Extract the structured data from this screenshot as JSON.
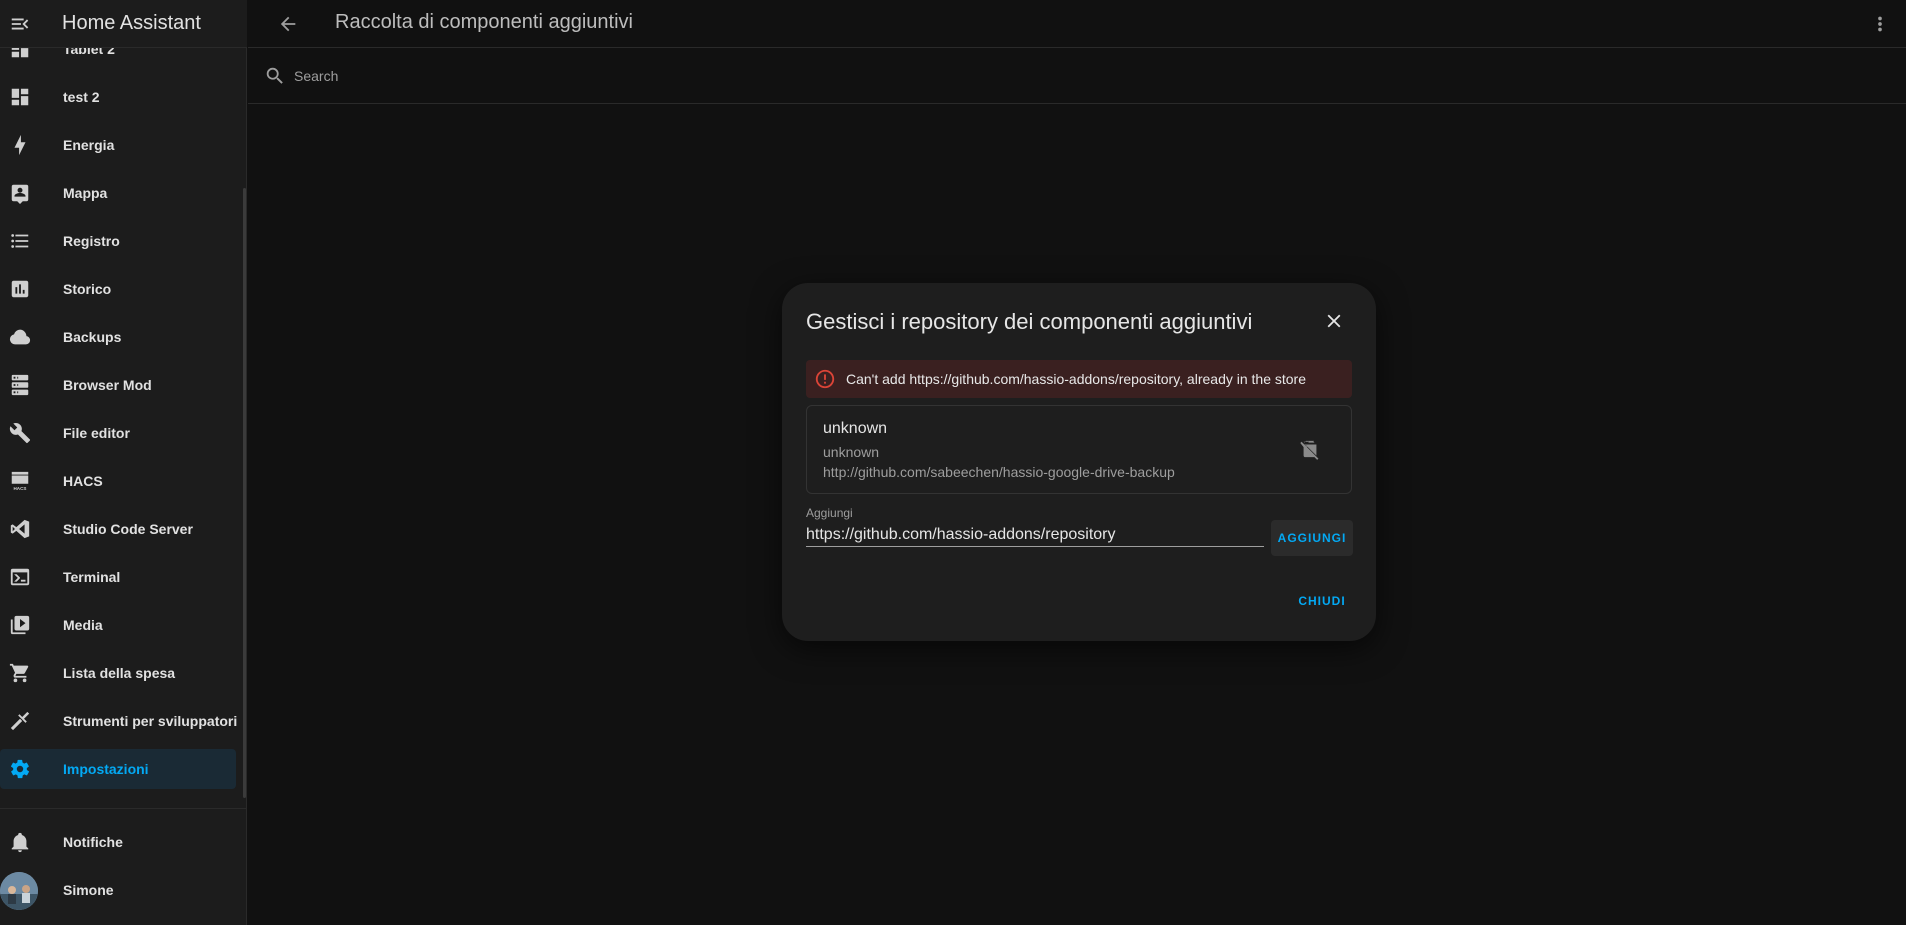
{
  "app": {
    "title": "Home Assistant"
  },
  "sidebar": {
    "items": [
      {
        "label": "Tablet 2",
        "icon": "view-dashboard-icon"
      },
      {
        "label": "test 2",
        "icon": "view-dashboard-icon"
      },
      {
        "label": "Energia",
        "icon": "lightning-bolt-icon"
      },
      {
        "label": "Mappa",
        "icon": "account-box-icon"
      },
      {
        "label": "Registro",
        "icon": "format-list-bulleted-icon"
      },
      {
        "label": "Storico",
        "icon": "chart-box-icon"
      },
      {
        "label": "Backups",
        "icon": "cloud-icon"
      },
      {
        "label": "Browser Mod",
        "icon": "server-icon"
      },
      {
        "label": "File editor",
        "icon": "wrench-icon"
      },
      {
        "label": "HACS",
        "icon": "hacs-icon"
      },
      {
        "label": "Studio Code Server",
        "icon": "vscode-icon"
      },
      {
        "label": "Terminal",
        "icon": "console-icon"
      },
      {
        "label": "Media",
        "icon": "play-box-multiple-icon"
      },
      {
        "label": "Lista della spesa",
        "icon": "cart-icon"
      },
      {
        "label": "Strumenti per sviluppatori",
        "icon": "hammer-icon"
      },
      {
        "label": "Impostazioni",
        "icon": "cog-icon",
        "active": true
      }
    ],
    "notifications_label": "Notifiche",
    "user_label": "Simone",
    "hacs_icon_text": "HACS"
  },
  "header": {
    "title": "Raccolta di componenti aggiuntivi"
  },
  "search": {
    "placeholder": "Search",
    "value": ""
  },
  "dialog": {
    "title": "Gestisci i repository dei componenti aggiuntivi",
    "error_text": "Can't add https://github.com/hassio-addons/repository, already in the store",
    "repository": {
      "name": "unknown",
      "maintainer": "unknown",
      "url": "http://github.com/sabeechen/hassio-google-drive-backup"
    },
    "add_label": "Aggiungi",
    "add_value": "https://github.com/hassio-addons/repository",
    "add_button": "AGGIUNGI",
    "close_button": "CHIUDI"
  },
  "colors": {
    "accent": "#03a9f4",
    "error": "#db4437",
    "background": "#111111",
    "sidebar": "#1c1c1c",
    "dialog": "#1e1e1e"
  }
}
